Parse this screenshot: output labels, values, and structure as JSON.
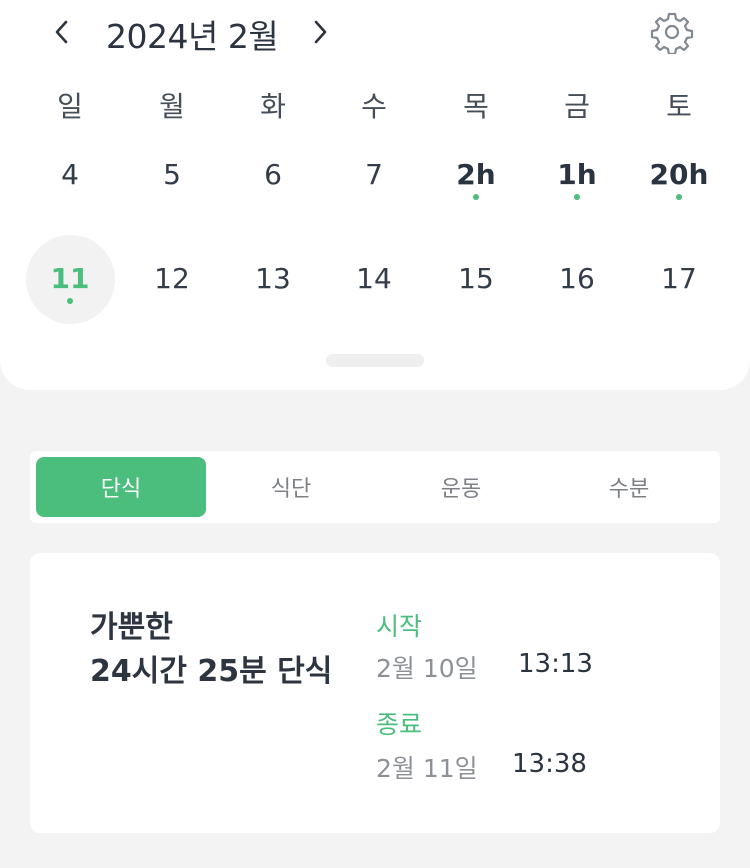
{
  "calendar": {
    "month_title": "2024년 2월",
    "weekdays": [
      "일",
      "월",
      "화",
      "수",
      "목",
      "금",
      "토"
    ],
    "week1": [
      {
        "label": "4",
        "bold": false,
        "dot": false
      },
      {
        "label": "5",
        "bold": false,
        "dot": false
      },
      {
        "label": "6",
        "bold": false,
        "dot": false
      },
      {
        "label": "7",
        "bold": false,
        "dot": false
      },
      {
        "label": "2h",
        "bold": true,
        "dot": true
      },
      {
        "label": "1h",
        "bold": true,
        "dot": true
      },
      {
        "label": "20h",
        "bold": true,
        "dot": true
      }
    ],
    "week2": [
      {
        "label": "11",
        "today": true,
        "dot": true
      },
      {
        "label": "12"
      },
      {
        "label": "13"
      },
      {
        "label": "14"
      },
      {
        "label": "15"
      },
      {
        "label": "16"
      },
      {
        "label": "17"
      }
    ]
  },
  "tabs": [
    {
      "label": "단식",
      "active": true
    },
    {
      "label": "식단",
      "active": false
    },
    {
      "label": "운동",
      "active": false
    },
    {
      "label": "수분",
      "active": false
    }
  ],
  "fasting": {
    "title_line1": "가뿐한",
    "title_line2": "24시간 25분 단식",
    "start_label": "시작",
    "start_date": "2월 10일",
    "start_time": "13:13",
    "end_label": "종료",
    "end_date": "2월 11일",
    "end_time": "13:38"
  },
  "colors": {
    "accent": "#4bbd7d",
    "background": "#f3f3f3",
    "text_dark": "#2b3440"
  },
  "icons": {
    "prev": "chevron-left-icon",
    "next": "chevron-right-icon",
    "settings": "gear-icon"
  }
}
